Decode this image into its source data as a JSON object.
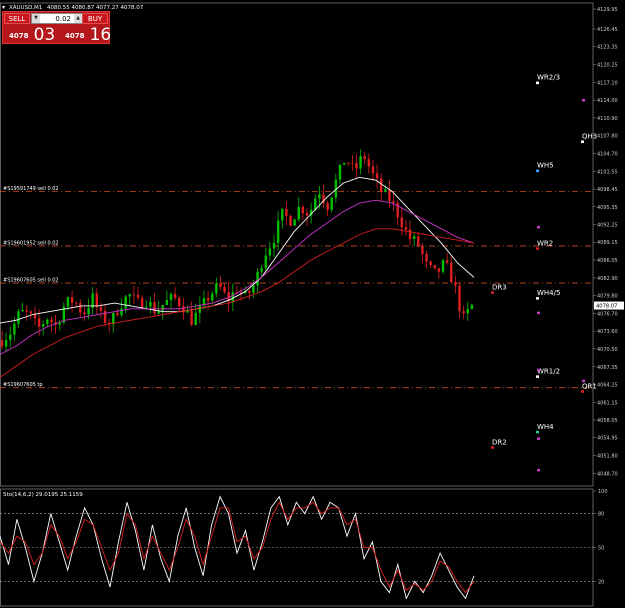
{
  "window": {
    "symbol_title": "XAUUSD,M1",
    "ohlc_readout": "4080.55 4080.87 4077.27 4078.07",
    "arrow_glyph": "▾"
  },
  "trade_panel": {
    "sell_label": "SELL",
    "buy_label": "BUY",
    "lot_value": "0.02",
    "down_arrow": "▼",
    "up_arrow": "▲",
    "sell_price_small": "4078",
    "sell_price_big": "03",
    "buy_price_small": "4078",
    "buy_price_big": "16"
  },
  "colors": {
    "background": "#000000",
    "bull_candle": "#00c000",
    "bear_candle": "#e02020",
    "ma_fast": "#ffffff",
    "ma_mid": "#cc33cc",
    "ma_slow": "#d42020",
    "order_line": "#c84e1e",
    "stoch_main": "#ffffff",
    "stoch_signal": "#e02020",
    "trade_panel": "#b5161b"
  },
  "chart_data": [
    {
      "type": "candlestick",
      "title": "XAUUSD,M1",
      "ylim": [
        4046.5,
        4131.0
      ],
      "y_tick_labels": [
        "4129.95",
        "4126.45",
        "4123.35",
        "4120.25",
        "4117.10",
        "4114.00",
        "4110.90",
        "4107.80",
        "4104.70",
        "4101.55",
        "4098.45",
        "4095.35",
        "4092.25",
        "4089.15",
        "4086.05",
        "4082.90",
        "4079.80",
        "4076.70",
        "4073.60",
        "4070.50",
        "4067.35",
        "4064.25",
        "4061.15",
        "4058.05",
        "4054.95",
        "4051.80",
        "4048.70"
      ],
      "current_price": "4078.07",
      "close_path": {
        "y": [
          4072.0,
          4073.5,
          4077.0,
          4076.5,
          4074.0,
          4076.0,
          4074.5,
          4078.5,
          4079.0,
          4076.5,
          4079.5,
          4076.0,
          4075.0,
          4078.0,
          4080.0,
          4078.5,
          4079.0,
          4077.0,
          4078.5,
          4079.5,
          4078.0,
          4075.5,
          4077.5,
          4080.0,
          4081.5,
          4079.0,
          4081.0,
          4079.5,
          4082.0,
          4087.0,
          4089.5,
          4094.0,
          4093.0,
          4095.5,
          4094.0,
          4098.5,
          4095.5,
          4100.0,
          4104.0,
          4101.5,
          4104.5,
          4101.0,
          4098.0,
          4096.5,
          4093.5,
          4090.0,
          4089.0,
          4085.0,
          4083.5,
          4085.5,
          4082.0,
          4075.5,
          4078.0
        ]
      },
      "moving_averages": [
        {
          "color_key": "ma_fast",
          "y": [
            4075.0,
            4075.5,
            4076.5,
            4077.0,
            4077.5,
            4078.0,
            4078.0,
            4078.5,
            4078.0,
            4077.5,
            4077.0,
            4077.0,
            4077.5,
            4078.0,
            4079.0,
            4080.5,
            4083.0,
            4087.0,
            4091.0,
            4094.0,
            4097.0,
            4099.5,
            4100.5,
            4100.0,
            4098.0,
            4095.0,
            4092.0,
            4089.0,
            4085.5,
            4083.0
          ]
        },
        {
          "color_key": "ma_mid",
          "y": [
            4069.5,
            4071.0,
            4073.0,
            4074.5,
            4075.5,
            4076.0,
            4076.5,
            4077.0,
            4077.5,
            4077.5,
            4077.5,
            4077.5,
            4078.0,
            4078.5,
            4079.5,
            4081.0,
            4083.0,
            4085.5,
            4088.0,
            4090.5,
            4092.5,
            4094.5,
            4096.0,
            4096.5,
            4096.0,
            4094.5,
            4093.0,
            4091.5,
            4090.0,
            4089.0
          ]
        },
        {
          "color_key": "ma_slow",
          "y": [
            4065.5,
            4067.5,
            4069.5,
            4071.0,
            4072.5,
            4073.5,
            4074.5,
            4075.0,
            4075.5,
            4076.0,
            4076.5,
            4077.0,
            4077.5,
            4078.0,
            4078.5,
            4079.5,
            4080.5,
            4082.0,
            4084.0,
            4086.0,
            4087.5,
            4089.0,
            4090.5,
            4091.5,
            4091.5,
            4091.0,
            4090.5,
            4090.0,
            4089.5,
            4089.0
          ]
        }
      ],
      "horizontal_lines": [
        {
          "label": "#S19591749  sell 0.02",
          "y": 4098.0
        },
        {
          "label": "#S19601952  sell 0.02",
          "y": 4088.5
        },
        {
          "label": "#S19607605  sell 0.02",
          "y": 4082.0
        },
        {
          "label": "#S19607605  tp",
          "y": 4063.7
        }
      ],
      "pivot_labels": [
        {
          "text": "WR2/3",
          "y": 4117.6,
          "marker_color": "#ffffff"
        },
        {
          "text": "QH3",
          "y": 4107.3,
          "marker_color": "#ffffff"
        },
        {
          "text": "WH5",
          "y": 4102.2,
          "marker_color": "#3aa0ff"
        },
        {
          "text": "WR2",
          "y": 4088.6,
          "marker_color": "#e02020"
        },
        {
          "text": "DR3",
          "y": 4080.9,
          "marker_color": "#e02020"
        },
        {
          "text": "WH4/5",
          "y": 4079.9,
          "marker_color": "#ffffff"
        },
        {
          "text": "WR1/2",
          "y": 4066.2,
          "marker_color": "#ffffff"
        },
        {
          "text": "QR1",
          "y": 4063.6,
          "marker_color": "#e02020"
        },
        {
          "text": "WH4",
          "y": 4056.5,
          "marker_color": "#22cc88"
        },
        {
          "text": "DR2",
          "y": 4053.8,
          "marker_color": "#e02020"
        }
      ],
      "violet_markers_y": [
        4114.2,
        4092.0,
        4077.0,
        4067.0,
        4065.1,
        4055.0,
        4049.5
      ]
    },
    {
      "type": "line",
      "title": "Sto(14,6,2) 29.0195 25.1159",
      "ylim": [
        0,
        100
      ],
      "levels": [
        80,
        50,
        20
      ],
      "y_tick_labels": [
        "100",
        "80",
        "50",
        "20"
      ],
      "series": [
        {
          "color_key": "stoch_main",
          "values": [
            60,
            35,
            75,
            50,
            20,
            45,
            80,
            55,
            30,
            60,
            85,
            70,
            40,
            15,
            55,
            90,
            65,
            30,
            70,
            40,
            20,
            60,
            85,
            50,
            25,
            70,
            95,
            80,
            45,
            65,
            30,
            55,
            85,
            95,
            70,
            90,
            80,
            95,
            75,
            90,
            85,
            60,
            80,
            40,
            55,
            20,
            10,
            35,
            5,
            20,
            10,
            25,
            45,
            30,
            15,
            5,
            25
          ]
        },
        {
          "color_key": "stoch_signal",
          "values": [
            55,
            45,
            60,
            55,
            35,
            45,
            70,
            60,
            40,
            55,
            75,
            70,
            50,
            30,
            45,
            80,
            70,
            40,
            60,
            45,
            30,
            50,
            75,
            60,
            35,
            60,
            85,
            85,
            55,
            60,
            40,
            50,
            75,
            90,
            75,
            85,
            85,
            90,
            80,
            85,
            85,
            70,
            75,
            50,
            50,
            30,
            15,
            30,
            12,
            18,
            12,
            20,
            38,
            33,
            20,
            10,
            20
          ]
        }
      ]
    }
  ]
}
